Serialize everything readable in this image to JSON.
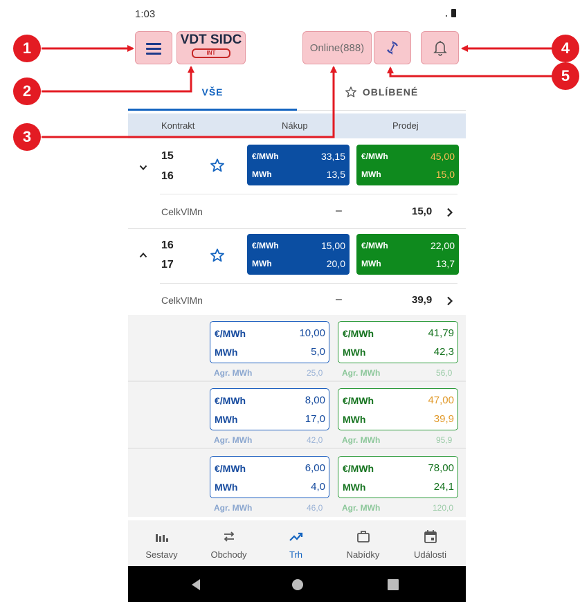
{
  "status_bar": {
    "time": "1:03"
  },
  "header": {
    "brand_title": "VDT SIDC",
    "brand_badge": "INT",
    "online_label": "Online(888)"
  },
  "tabs": [
    {
      "label": "VŠE",
      "active": true
    },
    {
      "label": "OBLÍBENÉ",
      "active": false
    }
  ],
  "columns": {
    "contract": "Kontrakt",
    "buy": "Nákup",
    "sell": "Prodej"
  },
  "contracts": [
    {
      "from": "15",
      "to": "16",
      "expanded": false,
      "buy": {
        "price_label": "€/MWh",
        "price": "33,15",
        "vol_label": "MWh",
        "vol": "13,5"
      },
      "sell": {
        "price_label": "€/MWh",
        "price": "45,00",
        "vol_label": "MWh",
        "vol": "15,0"
      },
      "summary_label": "CelkVlMn",
      "summary_dash": "–",
      "summary_value": "15,0"
    },
    {
      "from": "16",
      "to": "17",
      "expanded": true,
      "buy": {
        "price_label": "€/MWh",
        "price": "15,00",
        "vol_label": "MWh",
        "vol": "20,0"
      },
      "sell": {
        "price_label": "€/MWh",
        "price": "22,00",
        "vol_label": "MWh",
        "vol": "13,7"
      },
      "summary_label": "CelkVlMn",
      "summary_dash": "–",
      "summary_value": "39,9"
    }
  ],
  "depth": [
    {
      "buy": {
        "price_label": "€/MWh",
        "price": "10,00",
        "vol_label": "MWh",
        "vol": "5,0",
        "agr_label": "Agr. MWh",
        "agr": "25,0"
      },
      "sell": {
        "price_label": "€/MWh",
        "price": "41,79",
        "vol_label": "MWh",
        "vol": "42,3",
        "agr_label": "Agr. MWh",
        "agr": "56,0"
      }
    },
    {
      "buy": {
        "price_label": "€/MWh",
        "price": "8,00",
        "vol_label": "MWh",
        "vol": "17,0",
        "agr_label": "Agr. MWh",
        "agr": "42,0"
      },
      "sell": {
        "price_label": "€/MWh",
        "price": "47,00",
        "vol_label": "MWh",
        "vol": "39,9",
        "agr_label": "Agr. MWh",
        "agr": "95,9"
      }
    },
    {
      "buy": {
        "price_label": "€/MWh",
        "price": "6,00",
        "vol_label": "MWh",
        "vol": "4,0",
        "agr_label": "Agr. MWh",
        "agr": "46,0"
      },
      "sell": {
        "price_label": "€/MWh",
        "price": "78,00",
        "vol_label": "MWh",
        "vol": "24,1",
        "agr_label": "Agr. MWh",
        "agr": "120,0"
      }
    }
  ],
  "bottom_nav": [
    {
      "label": "Sestavy",
      "icon": "bar-chart-icon"
    },
    {
      "label": "Obchody",
      "icon": "swap-icon"
    },
    {
      "label": "Trh",
      "icon": "trending-up-icon",
      "active": true
    },
    {
      "label": "Nabídky",
      "icon": "briefcase-icon"
    },
    {
      "label": "Události",
      "icon": "calendar-icon"
    }
  ],
  "callouts": [
    "1",
    "2",
    "3",
    "4",
    "5"
  ],
  "colors": {
    "accent": "#1565c0",
    "buy": "#0b4ea2",
    "sell": "#0f8a1e",
    "highlight": "#f8c8cd",
    "callout": "#e31b23"
  }
}
